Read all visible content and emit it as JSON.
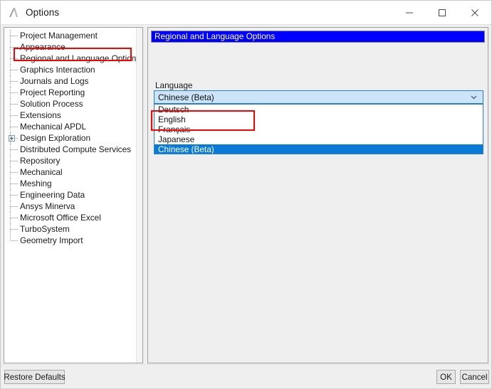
{
  "window": {
    "title": "Options",
    "app_icon": "ansys-logo-icon",
    "controls": {
      "minimize": "minimize-icon",
      "maximize": "maximize-icon",
      "close": "close-icon"
    }
  },
  "sidebar": {
    "items": [
      {
        "label": "Project Management",
        "expandable": false
      },
      {
        "label": "Appearance",
        "expandable": false
      },
      {
        "label": "Regional and Language Options",
        "expandable": false,
        "highlighted": true
      },
      {
        "label": "Graphics Interaction",
        "expandable": false
      },
      {
        "label": "Journals and Logs",
        "expandable": false
      },
      {
        "label": "Project Reporting",
        "expandable": false
      },
      {
        "label": "Solution Process",
        "expandable": false
      },
      {
        "label": "Extensions",
        "expandable": false
      },
      {
        "label": "Mechanical APDL",
        "expandable": false
      },
      {
        "label": "Design Exploration",
        "expandable": true
      },
      {
        "label": "Distributed Compute Services",
        "expandable": false
      },
      {
        "label": "Repository",
        "expandable": false
      },
      {
        "label": "Mechanical",
        "expandable": false
      },
      {
        "label": "Meshing",
        "expandable": false
      },
      {
        "label": "Engineering Data",
        "expandable": false
      },
      {
        "label": "Ansys Minerva",
        "expandable": false
      },
      {
        "label": "Microsoft Office Excel",
        "expandable": false
      },
      {
        "label": "TurboSystem",
        "expandable": false
      },
      {
        "label": "Geometry Import",
        "expandable": false
      }
    ]
  },
  "options_panel": {
    "section_header": "Regional and Language Options",
    "language": {
      "label": "Language",
      "selected": "Chinese (Beta)",
      "dropdown_open": true,
      "options": [
        {
          "label": "Deutsch",
          "selected": false
        },
        {
          "label": "English",
          "selected": false
        },
        {
          "label": "Français",
          "selected": false
        },
        {
          "label": "Japanese",
          "selected": false
        },
        {
          "label": "Chinese (Beta)",
          "selected": true
        }
      ]
    }
  },
  "footer": {
    "restore_defaults": "Restore Defaults",
    "ok": "OK",
    "cancel": "Cancel"
  },
  "annotations": {
    "accent_color": "#ff0000",
    "sidebar_highlight": "Regional and Language Options",
    "dropdown_highlight": "Chinese (Beta)"
  },
  "colors": {
    "section_header_bg": "#0000ff",
    "selected_option_bg": "#0a7ad8",
    "combo_bg": "#cce4f7",
    "window_bg": "#efefef"
  }
}
